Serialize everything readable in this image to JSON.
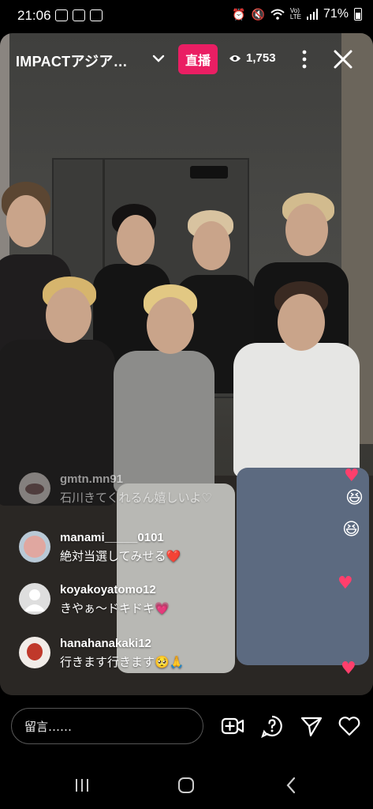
{
  "status_bar": {
    "time": "21:06",
    "battery": "71%",
    "left_icons": [
      "image-icon",
      "gallery-icon",
      "calendar-icon"
    ],
    "right_icons": [
      "alarm-icon",
      "mute-icon",
      "wifi-icon",
      "volte-icon",
      "signal-icon",
      "battery-icon"
    ]
  },
  "live": {
    "title": "IMPACTアジア…",
    "badge": "直播",
    "viewer_count": "1,753",
    "badge_color": "#ea1e63"
  },
  "comments": [
    {
      "username": "gmtn.mn91",
      "text": "石川きてくれるん嬉しいよ♡",
      "faded": true
    },
    {
      "username": "manami_____0101",
      "text": "絶対当選してみせる❤️"
    },
    {
      "username": "koyakoyatomo12",
      "text": "きやぁ〜ドキドキ💗"
    },
    {
      "username": "hanahanakaki12",
      "text": "行きます行きます🥺🙏"
    }
  ],
  "composer": {
    "placeholder": "留言……"
  },
  "actions": [
    "add-video-icon",
    "question-icon",
    "send-icon",
    "heart-icon"
  ],
  "nav": [
    "recents-icon",
    "home-icon",
    "back-icon"
  ]
}
